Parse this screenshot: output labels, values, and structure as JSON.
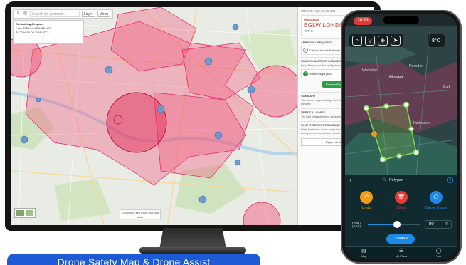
{
  "desktop": {
    "toolbar": {
      "search_placeholder": "Search for postcode...",
      "layers_label": "Layer",
      "menu_label": "Menu"
    },
    "info_box": {
      "line1": "Controlling Airspace",
      "line2": "From 2024-09-08 0925 UTC",
      "line3": "To 2024-09-08 1134 UTC"
    },
    "tooltip": "Zoom in to see more granular data",
    "panel": {
      "header": "WHERE YOU CLICKED",
      "card_label": "GUIDANCE",
      "card_title": "EGLW LONDON",
      "card_stars": "★★★",
      "approval_section": "APPROVAL REQUIRED",
      "approval_item": "Contact Airport Authority",
      "facility_section": "FACILITY & OTHER COMMENTS",
      "facility_text": "Read Airspace for this facility information before flying",
      "check_label": "Submit flight plan",
      "request_button": "Request Fly",
      "summary_section": "SUMMARY",
      "summary_text": "Your area is requested high level of operation of your drone in the area.",
      "vertical_section": "VERTICAL LIMITS",
      "vertical_text": "The limit of airspace from surface to 2000ft AGL.",
      "flight_section": "FLIGHT RESTRICTION ZONE",
      "flight_text": "Flight Restriction Zones protect aerodromes. To fly in this zone you need permission from the airport.",
      "report_button": "Report a Hazard"
    }
  },
  "phone": {
    "status_time": "16:13",
    "temperature": "8°C",
    "map_labels": [
      "Wembley",
      "Neasden",
      "Minster",
      "Harlesden",
      "Park"
    ],
    "sheet_title": "Polygon",
    "actions": [
      {
        "label": "Undo",
        "color": "#f39c12"
      },
      {
        "label": "Clear",
        "color": "#e53935"
      },
      {
        "label": "Close shape",
        "color": "#1e88e5"
      }
    ],
    "height_label_1": "Height",
    "height_label_2": "(AGL)",
    "height_value": "80",
    "height_unit": "m",
    "height_fraction": 0.55,
    "continue_label": "Continue",
    "tabs": [
      {
        "label": "Map",
        "icon": "▤"
      },
      {
        "label": "My Plans",
        "icon": "☰"
      },
      {
        "label": "You",
        "icon": "◯"
      }
    ]
  },
  "caption": "Drone Safety Map & Drone Assist"
}
